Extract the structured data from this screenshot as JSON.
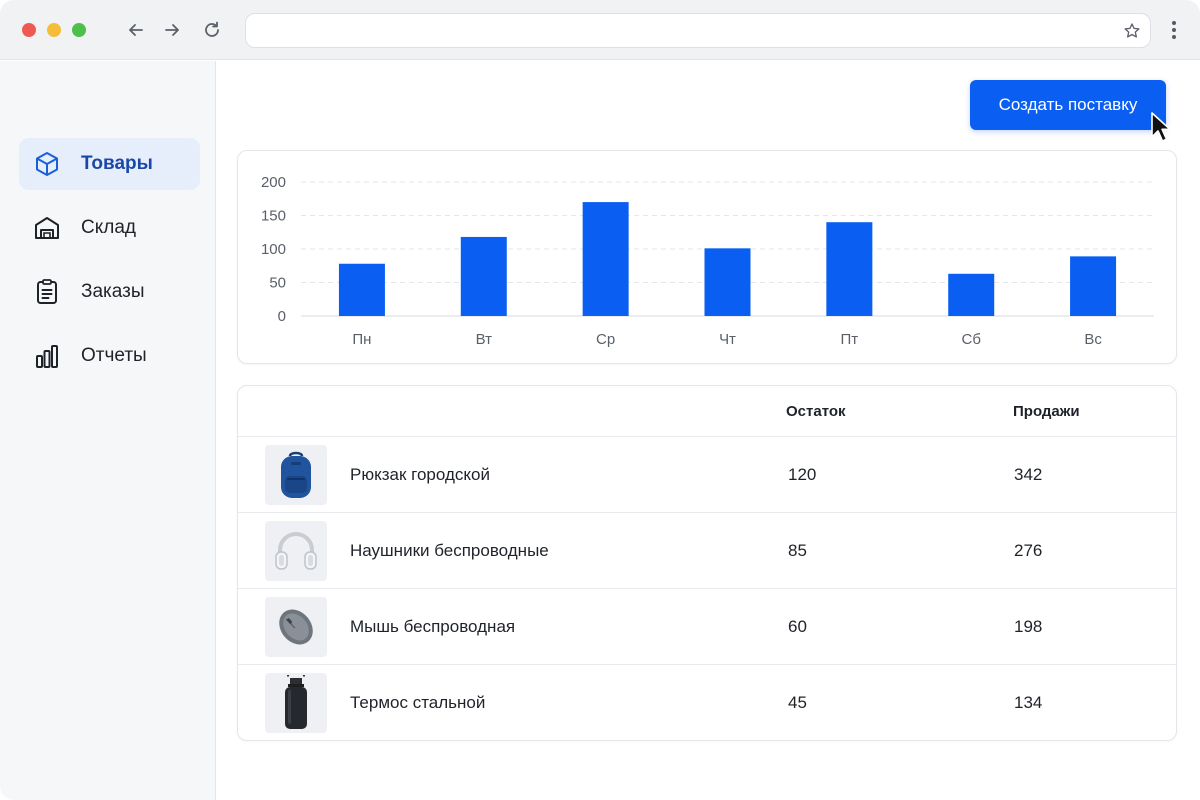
{
  "browser": {
    "address_value": "",
    "icons": [
      "back-arrow-icon",
      "forward-arrow-icon",
      "reload-icon",
      "bookmark-star-icon",
      "more-menu-icon"
    ]
  },
  "sidebar": {
    "items": [
      {
        "label": "Товары",
        "icon": "box-icon",
        "active": true
      },
      {
        "label": "Склад",
        "icon": "warehouse-icon",
        "active": false
      },
      {
        "label": "Заказы",
        "icon": "clipboard-icon",
        "active": false
      },
      {
        "label": "Отчеты",
        "icon": "bar-chart-icon",
        "active": false
      }
    ]
  },
  "toolbar": {
    "create_button_label": "Создать поставку"
  },
  "chart_data": {
    "type": "bar",
    "categories": [
      "Пн",
      "Вт",
      "Ср",
      "Чт",
      "Пт",
      "Сб",
      "Вс"
    ],
    "values": [
      78,
      118,
      170,
      101,
      140,
      63,
      89
    ],
    "ylim": [
      0,
      200
    ],
    "yticks": [
      "0",
      "50",
      "100",
      "150",
      "200"
    ],
    "grid": true,
    "color": "#0a5ff2"
  },
  "table": {
    "headers": {
      "product": "",
      "stock": "Остаток",
      "sales": "Продажи"
    },
    "rows": [
      {
        "name": "Рюкзак городской",
        "stock": "120",
        "sales": "342",
        "image": "backpack-icon"
      },
      {
        "name": "Наушники беспроводные",
        "stock": "85",
        "sales": "276",
        "image": "headphones-icon"
      },
      {
        "name": "Мышь беспроводная",
        "stock": "60",
        "sales": "198",
        "image": "mouse-icon"
      },
      {
        "name": "Термос стальной",
        "stock": "45",
        "sales": "134",
        "image": "thermos-icon"
      }
    ]
  },
  "colors": {
    "accent": "#0a5ff2",
    "active_nav_bg": "#e6eefc",
    "active_nav_text": "#1a47a8"
  }
}
